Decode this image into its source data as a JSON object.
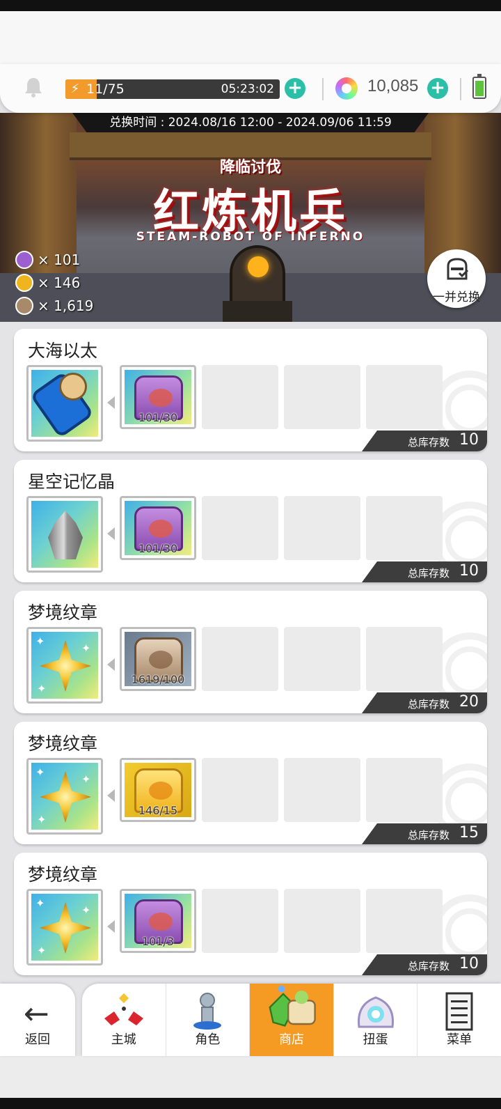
{
  "status": {
    "stamina_count": "11/75",
    "stamina_fill_fraction": 0.147,
    "stamina_timer": "05:23:02",
    "gem_count": "10,085"
  },
  "banner": {
    "exchange_period": "兑换时间 : 2024.08/16 12:00 - 2024.09/06 11:59",
    "subtitle": "降临讨伐",
    "title": "红炼机兵",
    "title_en": "STEAM-ROBOT OF INFERNO",
    "currencies": [
      {
        "icon": "purple-medal-icon",
        "text": "× 101",
        "color": "#9b5fd0"
      },
      {
        "icon": "gold-medal-icon",
        "text": "× 146",
        "color": "#f0b41e"
      },
      {
        "icon": "bronze-medal-icon",
        "text": "× 1,619",
        "color": "#a88a6b"
      }
    ],
    "batch_label": "一并兑换"
  },
  "items": [
    {
      "name": "大海以太",
      "reward_icon": "ether-capsule-icon",
      "cost_icon": "purple-medal-icon",
      "cost": "101/30",
      "stock_label": "总库存数",
      "stock": "10"
    },
    {
      "name": "星空记忆晶",
      "reward_icon": "memory-crystal-icon",
      "cost_icon": "purple-medal-icon",
      "cost": "101/30",
      "stock_label": "总库存数",
      "stock": "10"
    },
    {
      "name": "梦境纹章",
      "reward_icon": "dream-crest-icon",
      "cost_icon": "bronze-medal-icon",
      "cost": "1619/100",
      "stock_label": "总库存数",
      "stock": "20"
    },
    {
      "name": "梦境纹章",
      "reward_icon": "dream-crest-icon",
      "cost_icon": "gold-medal-icon",
      "cost": "146/15",
      "stock_label": "总库存数",
      "stock": "15"
    },
    {
      "name": "梦境纹章",
      "reward_icon": "dream-crest-icon",
      "cost_icon": "purple-medal-icon",
      "cost": "101/3",
      "stock_label": "总库存数",
      "stock": "10"
    }
  ],
  "nav": {
    "back": "返回",
    "tabs": [
      {
        "label": "主城",
        "icon": "castle-icon"
      },
      {
        "label": "角色",
        "icon": "character-icon"
      },
      {
        "label": "商店",
        "icon": "shop-icon",
        "active": true
      },
      {
        "label": "扭蛋",
        "icon": "gacha-icon"
      },
      {
        "label": "菜单",
        "icon": "menu-icon"
      }
    ]
  }
}
